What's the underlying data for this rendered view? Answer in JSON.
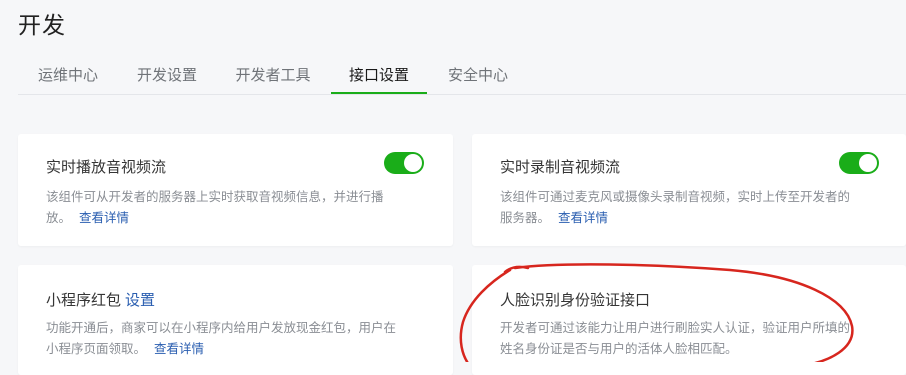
{
  "page": {
    "title": "开发"
  },
  "tabs": [
    {
      "label": "运维中心",
      "active": false
    },
    {
      "label": "开发设置",
      "active": false
    },
    {
      "label": "开发者工具",
      "active": false
    },
    {
      "label": "接口设置",
      "active": true
    },
    {
      "label": "安全中心",
      "active": false
    }
  ],
  "cards": [
    {
      "title": "实时播放音视频流",
      "desc_line1": "该组件可从开发者的服务器上实时获取音视频信息，并进行播",
      "desc_line2": "放。",
      "link": "查看详情",
      "toggle_on": true
    },
    {
      "title": "实时录制音视频流",
      "desc_line1": "该组件可通过麦克风或摄像头录制音视频，实时上传至开发者的",
      "desc_line2": "服务器。",
      "link": "查看详情",
      "toggle_on": true
    },
    {
      "title": "小程序红包",
      "title_link": "设置",
      "desc_line1": "功能开通后，商家可以在小程序内给用户发放现金红包，用户在",
      "desc_line2": "小程序页面领取。",
      "link": "查看详情"
    },
    {
      "title": "人脸识别身份验证接口",
      "desc_line1": "开发者可通过该能力让用户进行刷脸实人认证，验证用户所填的",
      "desc_line2": "姓名身份证是否与用户的活体人脸相匹配。"
    }
  ],
  "colors": {
    "accent": "#1aad19",
    "link": "#2a5eb0",
    "annotation": "#d7261e"
  }
}
